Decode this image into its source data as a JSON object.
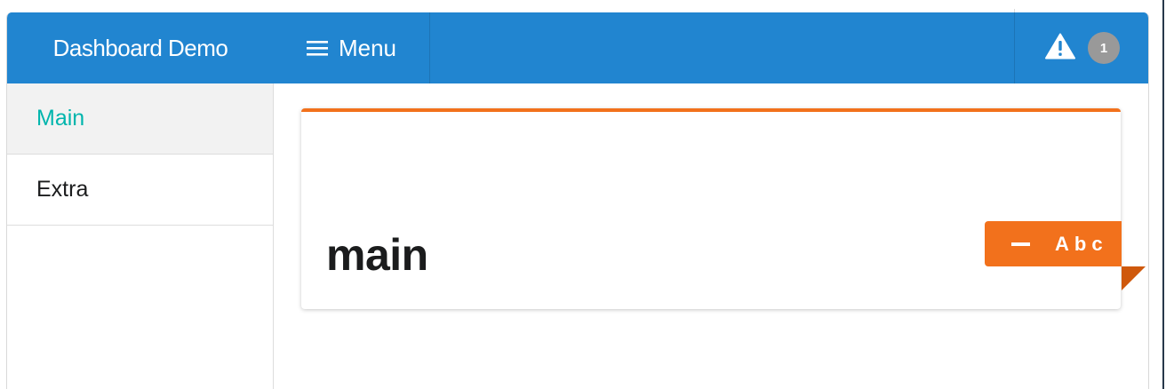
{
  "header": {
    "brand": "Dashboard Demo",
    "menu_label": "Menu",
    "menu_icon": "hamburger-icon",
    "alert_icon": "warning-icon",
    "alert_count": "1"
  },
  "sidebar": {
    "items": [
      {
        "label": "Main",
        "active": true
      },
      {
        "label": "Extra",
        "active": false
      }
    ]
  },
  "main": {
    "card": {
      "heading": "main",
      "ribbon_icon": "minus-icon",
      "ribbon_label": "Abc"
    }
  },
  "colors": {
    "header_bg": "#2185d0",
    "active_item": "#00b5ad",
    "accent": "#f2711c",
    "badge_bg": "#999999"
  }
}
